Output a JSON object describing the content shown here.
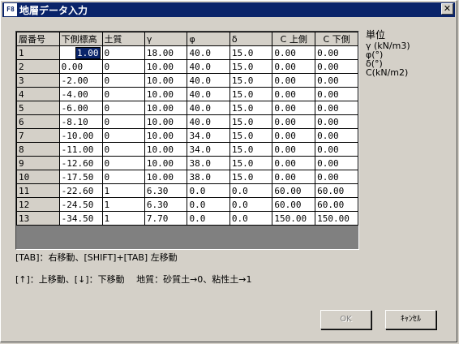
{
  "window": {
    "title": "地層データ入力",
    "app_icon": "F8",
    "close_symbol": "✕"
  },
  "grid": {
    "headers": [
      "層番号",
      "下側標高",
      "土質",
      "γ",
      "φ",
      "δ",
      "C 上側",
      "C 下側"
    ],
    "rows": [
      [
        "1",
        "1.00",
        "0",
        "18.00",
        "40.0",
        "15.0",
        "0.00",
        "0.00"
      ],
      [
        "2",
        "0.00",
        "0",
        "10.00",
        "40.0",
        "15.0",
        "0.00",
        "0.00"
      ],
      [
        "3",
        "-2.00",
        "0",
        "10.00",
        "40.0",
        "15.0",
        "0.00",
        "0.00"
      ],
      [
        "4",
        "-4.00",
        "0",
        "10.00",
        "40.0",
        "15.0",
        "0.00",
        "0.00"
      ],
      [
        "5",
        "-6.00",
        "0",
        "10.00",
        "40.0",
        "15.0",
        "0.00",
        "0.00"
      ],
      [
        "6",
        "-8.10",
        "0",
        "10.00",
        "40.0",
        "15.0",
        "0.00",
        "0.00"
      ],
      [
        "7",
        "-10.00",
        "0",
        "10.00",
        "34.0",
        "15.0",
        "0.00",
        "0.00"
      ],
      [
        "8",
        "-11.00",
        "0",
        "10.00",
        "34.0",
        "15.0",
        "0.00",
        "0.00"
      ],
      [
        "9",
        "-12.60",
        "0",
        "10.00",
        "38.0",
        "15.0",
        "0.00",
        "0.00"
      ],
      [
        "10",
        "-17.50",
        "0",
        "10.00",
        "38.0",
        "15.0",
        "0.00",
        "0.00"
      ],
      [
        "11",
        "-22.60",
        "1",
        "6.30",
        "0.0",
        "0.0",
        "60.00",
        "60.00"
      ],
      [
        "12",
        "-24.50",
        "1",
        "6.30",
        "0.0",
        "0.0",
        "60.00",
        "60.00"
      ],
      [
        "13",
        "-34.50",
        "1",
        "7.70",
        "0.0",
        "0.0",
        "150.00",
        "150.00"
      ]
    ]
  },
  "units": {
    "title": "単位",
    "lines": [
      "γ (kN/m3)",
      "φ(°)",
      "δ(°)",
      "C(kN/m2)"
    ]
  },
  "hints": {
    "line1": "[TAB]：右移動、[SHIFT]+[TAB] 左移動",
    "line2": "[↑]：上移動、[↓]：下移動　 地質：砂質土→0、粘性土→1"
  },
  "buttons": {
    "ok_label": "OK",
    "cancel_label": "ｷｬﾝｾﾙ"
  },
  "colors": {
    "titlebar": "#0a246a",
    "dialog_bg": "#d4d0c8",
    "selection": "#0a246a"
  }
}
